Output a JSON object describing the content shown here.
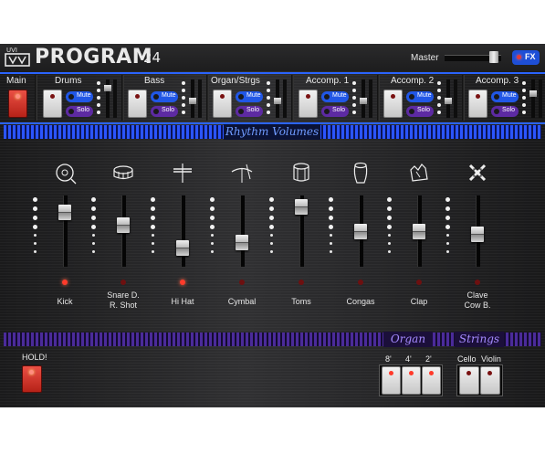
{
  "header": {
    "brand": "UVI",
    "title": "PROGRAM",
    "title_num": "24",
    "master_label": "Master",
    "master_level": 0.8,
    "fx_label": "FX"
  },
  "parts": {
    "main": "Main",
    "items": [
      {
        "name": "Drums",
        "mute": "Mute",
        "solo": "Solo"
      },
      {
        "name": "Bass",
        "mute": "Mute",
        "solo": "Solo"
      },
      {
        "name": "Organ/Strgs",
        "mute": "Mute",
        "solo": "Solo"
      },
      {
        "name": "Accomp. 1",
        "mute": "Mute",
        "solo": "Solo"
      },
      {
        "name": "Accomp. 2",
        "mute": "Mute",
        "solo": "Solo"
      },
      {
        "name": "Accomp. 3",
        "mute": "Mute",
        "solo": "Solo"
      }
    ]
  },
  "rhythm": {
    "section_label": "Rhythm Volumes",
    "channels": [
      {
        "label": "Kick",
        "icon": "kick-drum-icon",
        "level": 0.84,
        "active": true
      },
      {
        "label": "Snare D.\nR. Shot",
        "icon": "snare-drum-icon",
        "level": 0.6,
        "active": false
      },
      {
        "label": "Hi Hat",
        "icon": "hi-hat-icon",
        "level": 0.2,
        "active": true
      },
      {
        "label": "Cymbal",
        "icon": "cymbal-icon",
        "level": 0.3,
        "active": false
      },
      {
        "label": "Toms",
        "icon": "toms-icon",
        "level": 0.93,
        "active": false
      },
      {
        "label": "Congas",
        "icon": "conga-icon",
        "level": 0.5,
        "active": false
      },
      {
        "label": "Clap",
        "icon": "clap-icon",
        "level": 0.5,
        "active": false
      },
      {
        "label": "Clave\nCow B.",
        "icon": "clave-icon",
        "level": 0.45,
        "active": false
      }
    ]
  },
  "bottom": {
    "hold_label": "HOLD!",
    "organ_label": "Organ",
    "strings_label": "Strings",
    "organ_feet": [
      "8'",
      "4'",
      "2'"
    ],
    "strings_buttons": [
      "Cello",
      "Violin"
    ]
  },
  "colors": {
    "accent_blue": "#2b64ff",
    "accent_purple": "#5d2aa2",
    "led_red": "#ff3b2b"
  }
}
